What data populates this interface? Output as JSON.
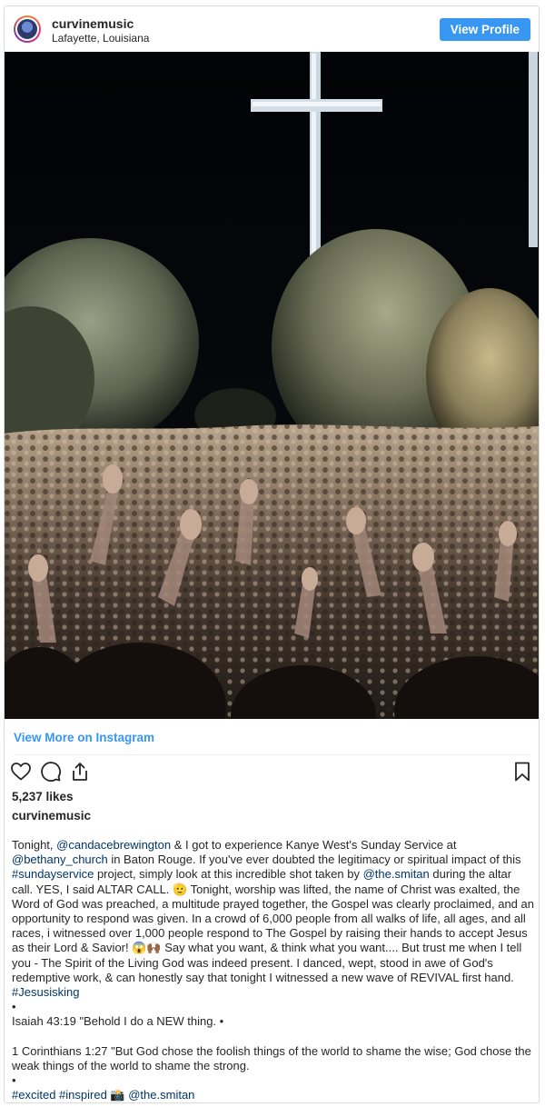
{
  "header": {
    "username": "curvinemusic",
    "location": "Lafayette, Louisiana",
    "view_profile_label": "View Profile"
  },
  "post": {
    "view_more_label": "View More on Instagram",
    "likes": "5,237 likes",
    "owner": "curvinemusic"
  },
  "icons": {
    "like": "heart-icon",
    "comment": "comment-icon",
    "share": "share-icon",
    "save": "bookmark-icon"
  },
  "colors": {
    "accent": "#3897f0",
    "hashtag": "#003569",
    "text": "#262626"
  },
  "caption": {
    "p1_pre": "Tonight, ",
    "m1": "@candacebrewington",
    "p1_a": " & I got to experience Kanye West's Sunday Service at ",
    "m2": "@bethany_church",
    "p1_b": " in Baton Rouge. If you've ever doubted the legitimacy or spiritual impact of this ",
    "h1": "#sundayservice",
    "p1_c": " project, simply look at this incredible shot taken by ",
    "m3": "@the.smitan",
    "p1_d": " during the altar call. YES, I said ALTAR CALL. 🫡 Tonight, worship was lifted, the name of Christ was exalted, the Word of God was preached, a multitude prayed together, the Gospel was clearly proclaimed, and an opportunity to respond was given. In a crowd of 6,000 people from all walks of life, all ages, and all races, i witnessed over 1,000 people respond to The Gospel by raising their hands to accept Jesus as their Lord & Savior! 😱🙌🏾 Say what you want, & think what you want.... But trust me when I tell you - The Spirit of the Living God was indeed present. I danced, wept, stood in awe of God's redemptive work, & can honestly say that tonight I witnessed a new wave of REVIVAL first hand. ",
    "h2": "#Jesusisking",
    "bullet1": "•",
    "isaiah": "Isaiah 43:19 \"Behold I do a NEW thing. •",
    "corinthians": "1 Corinthians 1:27 \"But God chose the foolish things of the world to shame the wise; God chose the weak things of the world to shame the strong.",
    "bullet2": "•",
    "h3": "#excited",
    "h4": "#inspired",
    "camera": " 📸 ",
    "m4": "@the.smitan"
  }
}
